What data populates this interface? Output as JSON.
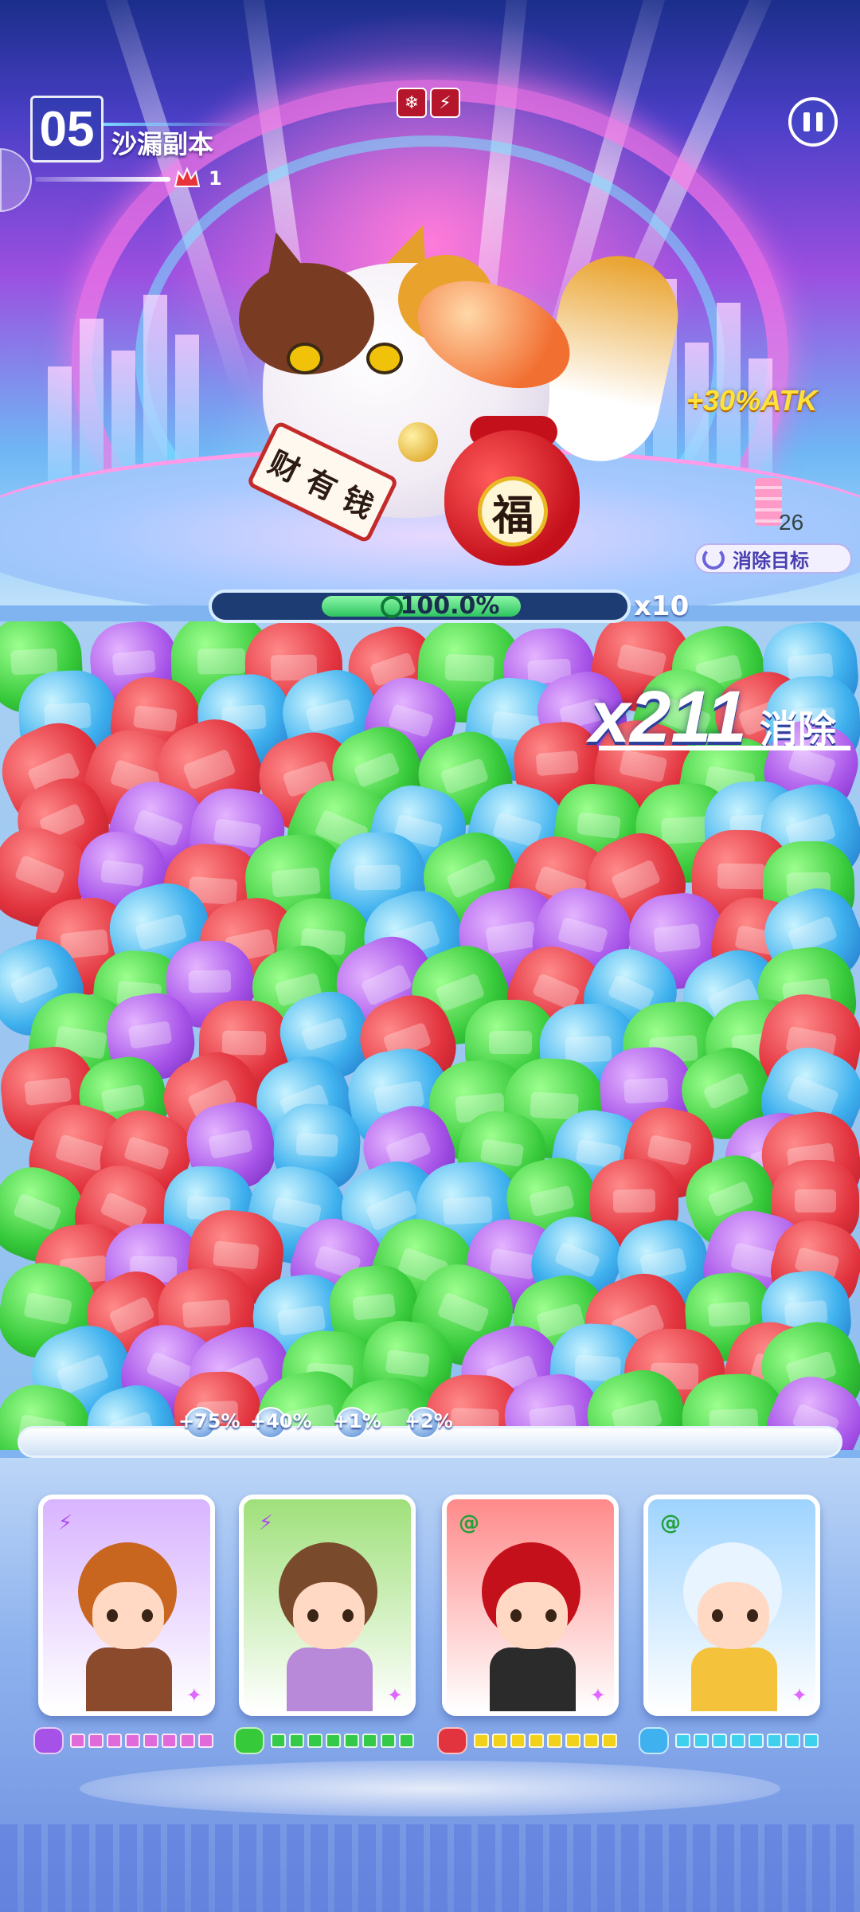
{
  "hud": {
    "level_number": "05",
    "level_name": "沙漏副本",
    "lives": "1",
    "buffs": [
      {
        "icon": "snowflake-icon",
        "glyph": "❄"
      },
      {
        "icon": "claw-icon",
        "glyph": "⚡"
      }
    ],
    "pause_icon": "pause-icon"
  },
  "boss": {
    "scroll_text": "财 有 钱",
    "bag_text": "福",
    "atk_bonus": "+30%ATK",
    "hp_percent_text": "100.0%",
    "hp_percent": 1.0,
    "hp_multiplier": "x10",
    "target_count": "26",
    "target_label": "消除目标"
  },
  "combo": {
    "count": "x211",
    "label": "消除"
  },
  "bonuses": [
    {
      "icon": "hero-bonus-icon",
      "value": "+75%"
    },
    {
      "icon": "hero-bonus-icon",
      "value": "+40%"
    },
    {
      "icon": "hero-bonus-icon",
      "value": "+1%"
    },
    {
      "icon": "hero-bonus-icon",
      "value": "+2%"
    }
  ],
  "heroes": [
    {
      "name": "lion-hood-hero",
      "badge": "⚡",
      "badge_color": "#b04df0",
      "bg": "#d8b4ff",
      "head": "#c8651f",
      "body": "#8b4a2b",
      "energy_color": "#e06ad9",
      "energy_filled": 8,
      "energy_icon_color": "#a652e8"
    },
    {
      "name": "skull-hat-hero",
      "badge": "⚡",
      "badge_color": "#b04df0",
      "bg": "#9fe07a",
      "head": "#7a4a2c",
      "body": "#b889d8",
      "energy_color": "#35c94a",
      "energy_filled": 8,
      "energy_icon_color": "#36c93a"
    },
    {
      "name": "opera-hero",
      "badge": "@",
      "badge_color": "#22a03a",
      "bg": "#ff8a8a",
      "head": "#c4101b",
      "body": "#2b2b2b",
      "energy_color": "#f2d11b",
      "energy_filled": 8,
      "energy_icon_color": "#e2343f"
    },
    {
      "name": "astronaut-dog-hero",
      "badge": "@",
      "badge_color": "#22a03a",
      "bg": "#9fd4ff",
      "head": "#e8f4ff",
      "body": "#f5c33b",
      "energy_color": "#3fd0ee",
      "energy_filled": 8,
      "energy_icon_color": "#3fb1ee"
    }
  ],
  "board": {
    "gem_types": [
      "red",
      "green",
      "purple",
      "blue"
    ]
  }
}
